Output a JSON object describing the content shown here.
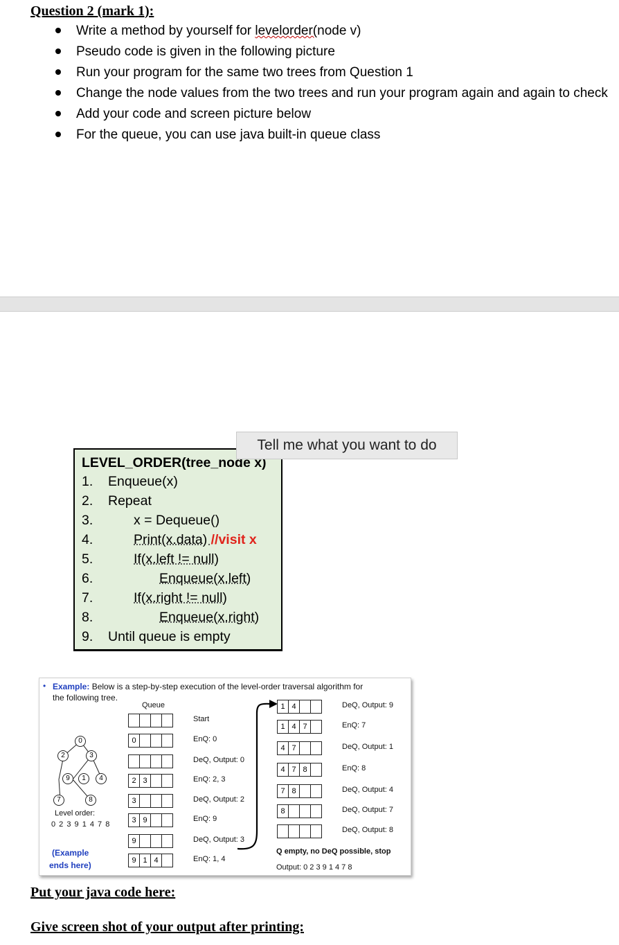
{
  "question": {
    "title": "Question 2 (mark 1):",
    "bullets": [
      {
        "pre": "Write a method by yourself for ",
        "squiggle": "levelorder(",
        "post": "node v)"
      },
      {
        "pre": "Pseudo code is given in the following picture",
        "squiggle": "",
        "post": ""
      },
      {
        "pre": "Run your program for the same two trees from Question 1",
        "squiggle": "",
        "post": ""
      },
      {
        "pre": "Change the node values from the two trees and run your program again and again to check",
        "squiggle": "",
        "post": ""
      },
      {
        "pre": "Add your code and screen picture below",
        "squiggle": "",
        "post": ""
      },
      {
        "pre": "For the queue, you can use java built-in queue class",
        "squiggle": "",
        "post": ""
      }
    ]
  },
  "tooltip": "Tell me what you want to do",
  "pseudocode": {
    "title": "LEVEL_ORDER(tree_node x)",
    "lines": [
      {
        "num": "1.",
        "text": "Enqueue(x)",
        "comment": ""
      },
      {
        "num": "2.",
        "text": "Repeat",
        "comment": ""
      },
      {
        "num": "3.",
        "text": "x = Dequeue()",
        "comment": ""
      },
      {
        "num": "4.",
        "text": "Print(x.data) ",
        "comment": "//visit x"
      },
      {
        "num": "5.",
        "text": "If(x.left != null)",
        "comment": ""
      },
      {
        "num": "6.",
        "text": "Enqueue(x.left)",
        "comment": ""
      },
      {
        "num": "7.",
        "text": "If(x.right != null)",
        "comment": ""
      },
      {
        "num": "8.",
        "text": "Enqueue(x.right)",
        "comment": ""
      },
      {
        "num": "9.",
        "text": "Until queue is empty",
        "comment": ""
      }
    ]
  },
  "example": {
    "label": "Example:",
    "intro_line1": " Below is a step-by-step execution of the level-order traversal algorithm for",
    "intro_line2": "the following tree.",
    "queue_header": "Queue",
    "tree_nodes": [
      "0",
      "2",
      "3",
      "9",
      "1",
      "4",
      "7",
      "8"
    ],
    "level_order_label": "Level order:",
    "level_order_value": "0 2 3 9 1 4 7 8",
    "end_note_line1": "(Example",
    "end_note_line2": "ends here)",
    "left_queues": [
      {
        "cells": [
          "",
          "",
          "",
          ""
        ],
        "step": "Start"
      },
      {
        "cells": [
          "0",
          "",
          "",
          ""
        ],
        "step": "EnQ: 0"
      },
      {
        "cells": [
          "",
          "",
          "",
          ""
        ],
        "step": "DeQ, Output: 0"
      },
      {
        "cells": [
          "2",
          "3",
          "",
          ""
        ],
        "step": "EnQ: 2, 3"
      },
      {
        "cells": [
          "3",
          "",
          "",
          ""
        ],
        "step": "DeQ, Output: 2"
      },
      {
        "cells": [
          "3",
          "9",
          "",
          ""
        ],
        "step": "EnQ: 9"
      },
      {
        "cells": [
          "9",
          "",
          "",
          ""
        ],
        "step": "DeQ, Output: 3"
      },
      {
        "cells": [
          "9",
          "1",
          "4",
          ""
        ],
        "step": "EnQ: 1, 4"
      }
    ],
    "right_queues": [
      {
        "cells": [
          "1",
          "4",
          "",
          ""
        ],
        "step": "DeQ, Output: 9"
      },
      {
        "cells": [
          "1",
          "4",
          "7",
          ""
        ],
        "step": "EnQ: 7"
      },
      {
        "cells": [
          "4",
          "7",
          "",
          ""
        ],
        "step": "DeQ, Output: 1"
      },
      {
        "cells": [
          "4",
          "7",
          "8",
          ""
        ],
        "step": "EnQ: 8"
      },
      {
        "cells": [
          "7",
          "8",
          "",
          ""
        ],
        "step": "DeQ, Output: 4"
      },
      {
        "cells": [
          "8",
          "",
          "",
          ""
        ],
        "step": "DeQ, Output: 7"
      },
      {
        "cells": [
          "",
          "",
          "",
          ""
        ],
        "step": "DeQ, Output: 8"
      }
    ],
    "final_note": "Q empty, no DeQ possible, stop",
    "final_output": "Output: 0 2 3 9 1 4 7 8"
  },
  "put_code_heading": "Put your java code here:",
  "screenshot_heading": "Give screen shot of your output after printing:"
}
